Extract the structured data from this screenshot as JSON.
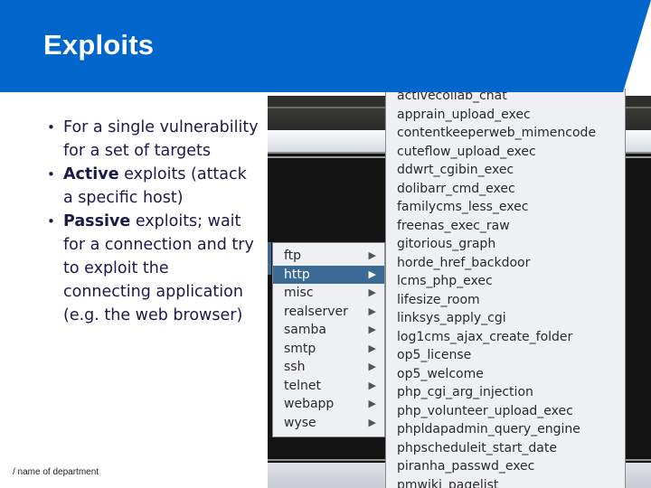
{
  "slide": {
    "title": "Exploits",
    "footer": "/ name of department"
  },
  "bullets": [
    {
      "bold": "",
      "text": "For a single vulnerability for a set of targets"
    },
    {
      "bold": "Active",
      "text": " exploits (attack a specific host)"
    },
    {
      "bold": "Passive",
      "text": " exploits; wait for a connection and try to exploit the connecting application (e.g. the web browser)"
    }
  ],
  "category_menu": {
    "selected": "http",
    "items": [
      {
        "label": "ftp",
        "icon": "submenu-arrow-icon"
      },
      {
        "label": "http",
        "icon": "submenu-arrow-icon"
      },
      {
        "label": "misc",
        "icon": "submenu-arrow-icon"
      },
      {
        "label": "realserver",
        "icon": "submenu-arrow-icon"
      },
      {
        "label": "samba",
        "icon": "submenu-arrow-icon"
      },
      {
        "label": "smtp",
        "icon": "submenu-arrow-icon"
      },
      {
        "label": "ssh",
        "icon": "submenu-arrow-icon"
      },
      {
        "label": "telnet",
        "icon": "submenu-arrow-icon"
      },
      {
        "label": "webapp",
        "icon": "submenu-arrow-icon"
      },
      {
        "label": "wyse",
        "icon": "submenu-arrow-icon"
      }
    ],
    "arrow_glyph": "▶"
  },
  "exploit_menu": {
    "items": [
      "activecollab_chat",
      "apprain_upload_exec",
      "contentkeeperweb_mimencode",
      "cuteflow_upload_exec",
      "ddwrt_cgibin_exec",
      "dolibarr_cmd_exec",
      "familycms_less_exec",
      "freenas_exec_raw",
      "gitorious_graph",
      "horde_href_backdoor",
      "lcms_php_exec",
      "lifesize_room",
      "linksys_apply_cgi",
      "log1cms_ajax_create_folder",
      "op5_license",
      "op5_welcome",
      "php_cgi_arg_injection",
      "php_volunteer_upload_exec",
      "phpldapadmin_query_engine",
      "phpscheduleit_start_date",
      "piranha_passwd_exec",
      "pmwiki_pagelist"
    ]
  },
  "colors": {
    "header_blue": "#0066cc",
    "selection_blue": "#3b6a95",
    "menu_bg": "#eff0f4",
    "bullet_text": "#1a1a4a"
  }
}
